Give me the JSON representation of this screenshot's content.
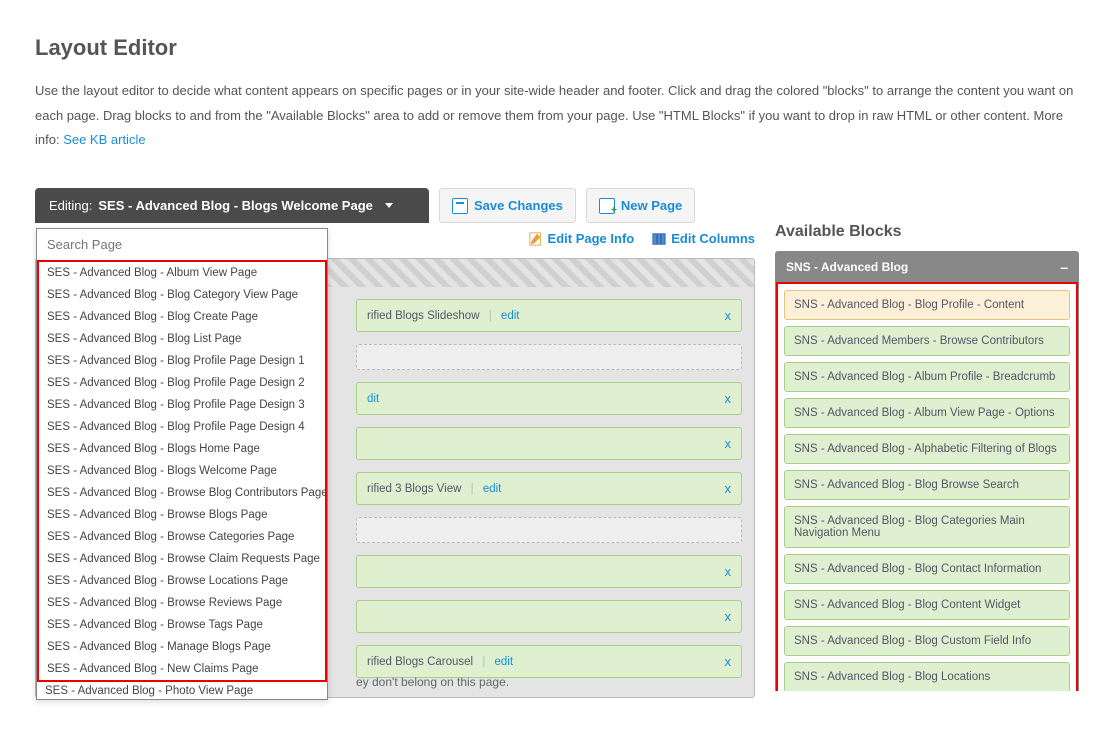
{
  "title": "Layout Editor",
  "intro_text": "Use the layout editor to decide what content appears on specific pages or in your site-wide header and footer. Click and drag the colored \"blocks\" to arrange the content you want on each page. Drag blocks to and from the \"Available Blocks\" area to add or remove them from your page. Use \"HTML Blocks\" if you want to drop in raw HTML or other content. More info: ",
  "intro_link": "See KB article",
  "editing_label": "Editing:",
  "editing_page": "SES - Advanced Blog - Blogs Welcome Page",
  "save_btn": "Save Changes",
  "newpage_btn": "New Page",
  "search_placeholder": "Search Page",
  "dropdown_items": [
    "SES - Advanced Blog - Album View Page",
    "SES - Advanced Blog - Blog Category View Page",
    "SES - Advanced Blog - Blog Create Page",
    "SES - Advanced Blog - Blog List Page",
    "SES - Advanced Blog - Blog Profile Page Design 1",
    "SES - Advanced Blog - Blog Profile Page Design 2",
    "SES - Advanced Blog - Blog Profile Page Design 3",
    "SES - Advanced Blog - Blog Profile Page Design 4",
    "SES - Advanced Blog - Blogs Home Page",
    "SES - Advanced Blog - Blogs Welcome Page",
    "SES - Advanced Blog - Browse Blog Contributors Page",
    "SES - Advanced Blog - Browse Blogs Page",
    "SES - Advanced Blog - Browse Categories Page",
    "SES - Advanced Blog - Browse Claim Requests Page",
    "SES - Advanced Blog - Browse Locations Page",
    "SES - Advanced Blog - Browse Reviews Page",
    "SES - Advanced Blog - Browse Tags Page",
    "SES - Advanced Blog - Manage Blogs Page",
    "SES - Advanced Blog - New Claims Page"
  ],
  "dropdown_extra": "SES - Advanced Blog - Photo View Page",
  "edit_page_info": "Edit Page Info",
  "edit_columns": "Edit Columns",
  "edit_link": "edit",
  "close_x": "x",
  "row1": "rified Blogs Slideshow",
  "row2": "dit",
  "row3": "rified 3 Blogs View",
  "row4": "rified Blogs Carousel",
  "canvas_hint": "ey don't belong on this page.",
  "avail_header": "Available Blocks",
  "avail_section": "SNS - Advanced Blog",
  "avail_collapse": "–",
  "avail_blocks": [
    "SNS - Advanced Blog - Blog Profile - Content",
    "SNS - Advanced Members - Browse Contributors",
    "SNS - Advanced Blog - Album Profile - Breadcrumb",
    "SNS - Advanced Blog - Album View Page - Options",
    "SNS - Advanced Blog - Alphabetic Filtering of Blogs",
    "SNS - Advanced Blog - Blog Browse Search",
    "SNS - Advanced Blog - Blog Categories Main Navigation Menu",
    "SNS - Advanced Blog - Blog Contact Information",
    "SNS - Advanced Blog - Blog Content Widget",
    "SNS - Advanced Blog - Blog Custom Field Info",
    "SNS - Advanced Blog - Blog Locations"
  ]
}
